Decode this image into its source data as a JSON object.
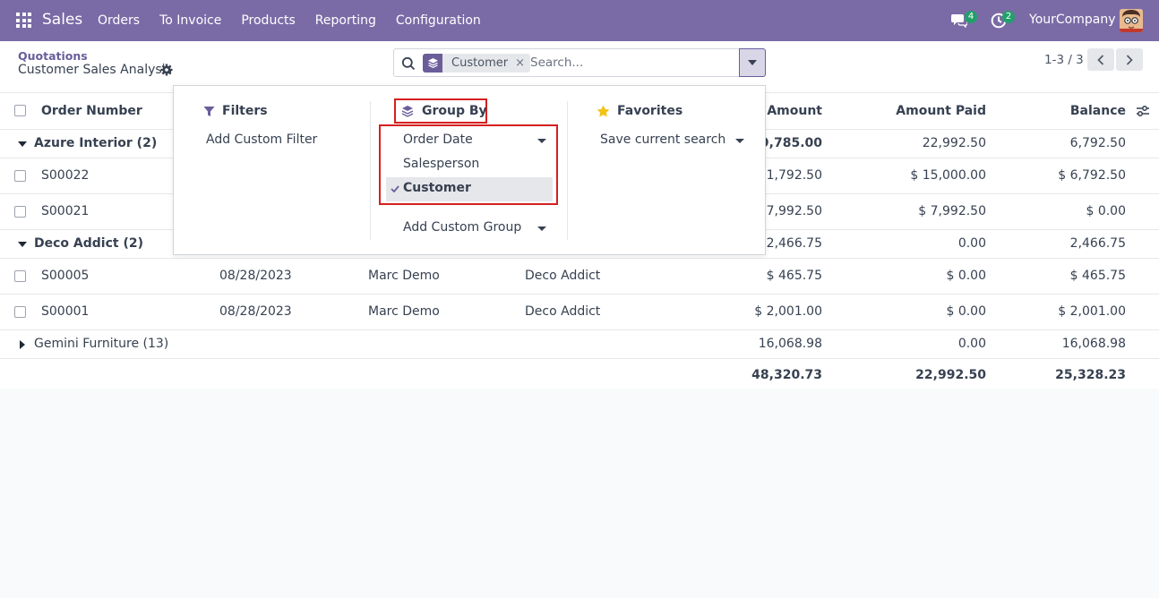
{
  "navbar": {
    "app_name": "Sales",
    "menu": [
      "Orders",
      "To Invoice",
      "Products",
      "Reporting",
      "Configuration"
    ],
    "chat_count": "4",
    "activity_count": "2",
    "company": "YourCompany",
    "bg_color": "#7a6ba6"
  },
  "control_panel": {
    "breadcrumb": "Quotations",
    "title": "Customer Sales Analysis",
    "search": {
      "facet_label": "Customer",
      "facet_close": "×",
      "placeholder": "Search..."
    },
    "pager": "1-3 / 3"
  },
  "dropdown": {
    "filters": {
      "title": "Filters",
      "add_custom": "Add Custom Filter"
    },
    "group_by": {
      "title": "Group By",
      "items": [
        {
          "label": "Order Date",
          "checked": false,
          "has_caret": true
        },
        {
          "label": "Salesperson",
          "checked": false,
          "has_caret": false
        },
        {
          "label": "Customer",
          "checked": true,
          "has_caret": false
        }
      ],
      "add_custom": "Add Custom Group"
    },
    "favorites": {
      "title": "Favorites",
      "save_search": "Save current search"
    }
  },
  "table": {
    "columns": {
      "order_number": "Order Number",
      "amount": "s Amount",
      "amount_paid": "Amount Paid",
      "balance": "Balance"
    },
    "rows": [
      {
        "kind": "group",
        "label": "Azure Interior (2)",
        "expanded": true,
        "amount": "29,785.00",
        "paid": "22,992.50",
        "balance": "6,792.50"
      },
      {
        "kind": "record",
        "number": "S00022",
        "date": "",
        "salesperson": "",
        "customer": "",
        "amount": "21,792.50",
        "paid": "$ 15,000.00",
        "balance": "$ 6,792.50"
      },
      {
        "kind": "record",
        "number": "S00021",
        "date": "",
        "salesperson": "",
        "customer": "",
        "amount": "$ 7,992.50",
        "paid": "$ 7,992.50",
        "balance": "$ 0.00"
      },
      {
        "kind": "group",
        "label": "Deco Addict (2)",
        "expanded": true,
        "amount": "2,466.75",
        "paid": "0.00",
        "balance": "2,466.75"
      },
      {
        "kind": "record",
        "number": "S00005",
        "date": "08/28/2023",
        "salesperson": "Marc Demo",
        "customer": "Deco Addict",
        "amount": "$ 465.75",
        "paid": "$ 0.00",
        "balance": "$ 465.75"
      },
      {
        "kind": "record",
        "number": "S00001",
        "date": "08/28/2023",
        "salesperson": "Marc Demo",
        "customer": "Deco Addict",
        "amount": "$ 2,001.00",
        "paid": "$ 0.00",
        "balance": "$ 2,001.00"
      },
      {
        "kind": "group",
        "label": "Gemini Furniture (13)",
        "expanded": false,
        "amount": "16,068.98",
        "paid": "0.00",
        "balance": "16,068.98"
      }
    ],
    "totals": {
      "amount": "48,320.73",
      "paid": "22,992.50",
      "balance": "25,328.23"
    }
  }
}
